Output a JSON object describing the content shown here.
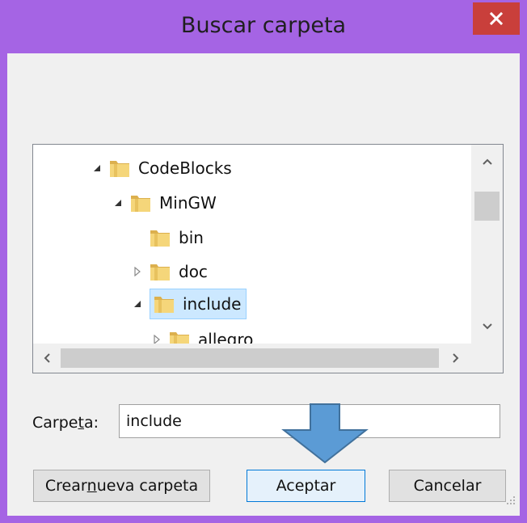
{
  "window": {
    "title": "Buscar carpeta",
    "close_label": "×",
    "title_bar_color": "#a564e4",
    "close_color": "#c93f3b"
  },
  "tree": {
    "items": [
      {
        "label": "CodeBlocks",
        "expander": "expanded"
      },
      {
        "label": "MinGW",
        "expander": "expanded"
      },
      {
        "label": "bin",
        "expander": "none"
      },
      {
        "label": "doc",
        "expander": "collapsed"
      },
      {
        "label": "include",
        "expander": "expanded",
        "selected": true
      },
      {
        "label": "allegro",
        "expander": "collapsed"
      }
    ],
    "selection_color": "#cce8ff"
  },
  "folder_field": {
    "label_prefix": "Carpe",
    "label_accel": "t",
    "label_suffix": "a:",
    "value": "include"
  },
  "buttons": {
    "new_folder_prefix": "Crear ",
    "new_folder_accel": "n",
    "new_folder_suffix": "ueva carpeta",
    "accept": "Aceptar",
    "cancel": "Cancelar"
  },
  "annotation": {
    "arrow_color": "#5b9bd5",
    "arrow_icon": "down-arrow-icon"
  }
}
